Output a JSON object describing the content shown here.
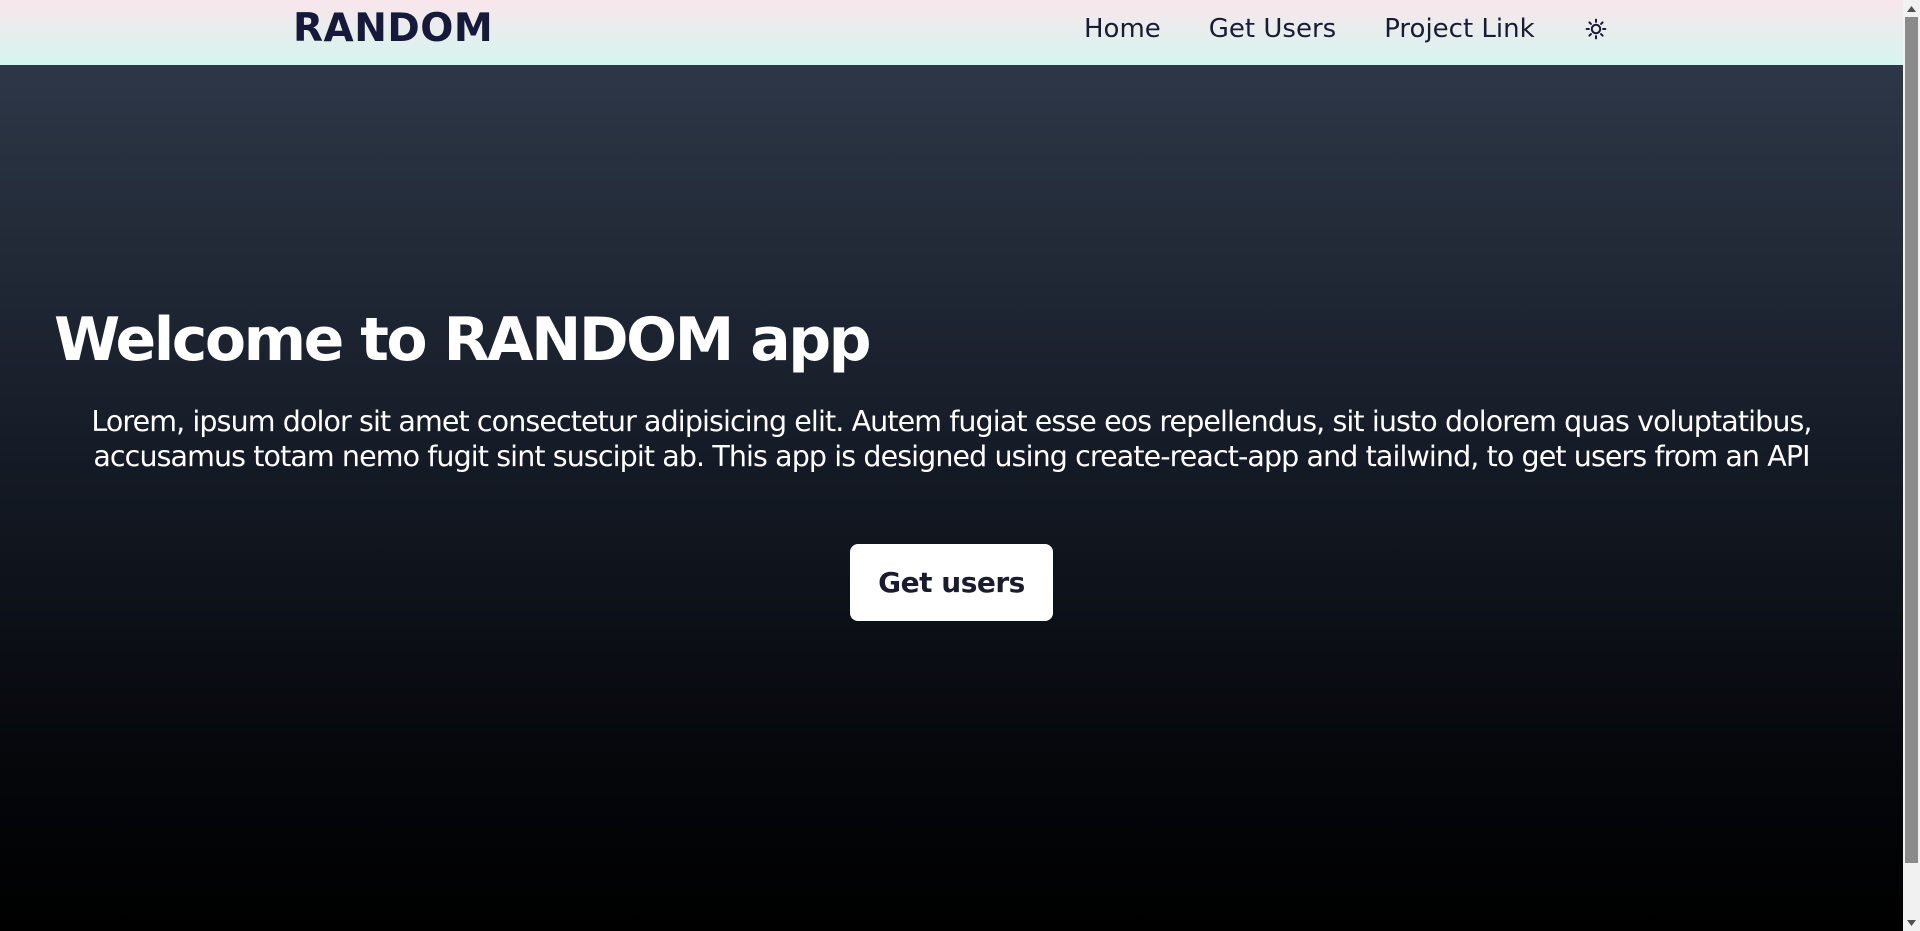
{
  "navbar": {
    "logo": "RANDOM",
    "links": [
      {
        "label": "Home"
      },
      {
        "label": "Get Users"
      },
      {
        "label": "Project Link"
      }
    ],
    "theme_toggle_icon": "sun-icon"
  },
  "hero": {
    "title": "Welcome to RANDOM app",
    "description": "Lorem, ipsum dolor sit amet consectetur adipisicing elit. Autem fugiat esse eos repellendus, sit iusto dolorem quas voluptatibus, accusamus totam nemo fugit sint suscipit ab. This app is designed using create-react-app and tailwind, to get users from an API",
    "button_label": "Get users"
  },
  "colors": {
    "navbar_top": "#f9e6ec",
    "navbar_bottom": "#d6f5ee",
    "hero_top": "#2d3747",
    "hero_bottom": "#000000",
    "text_dark": "#16193a",
    "button_bg": "#ffffff"
  }
}
